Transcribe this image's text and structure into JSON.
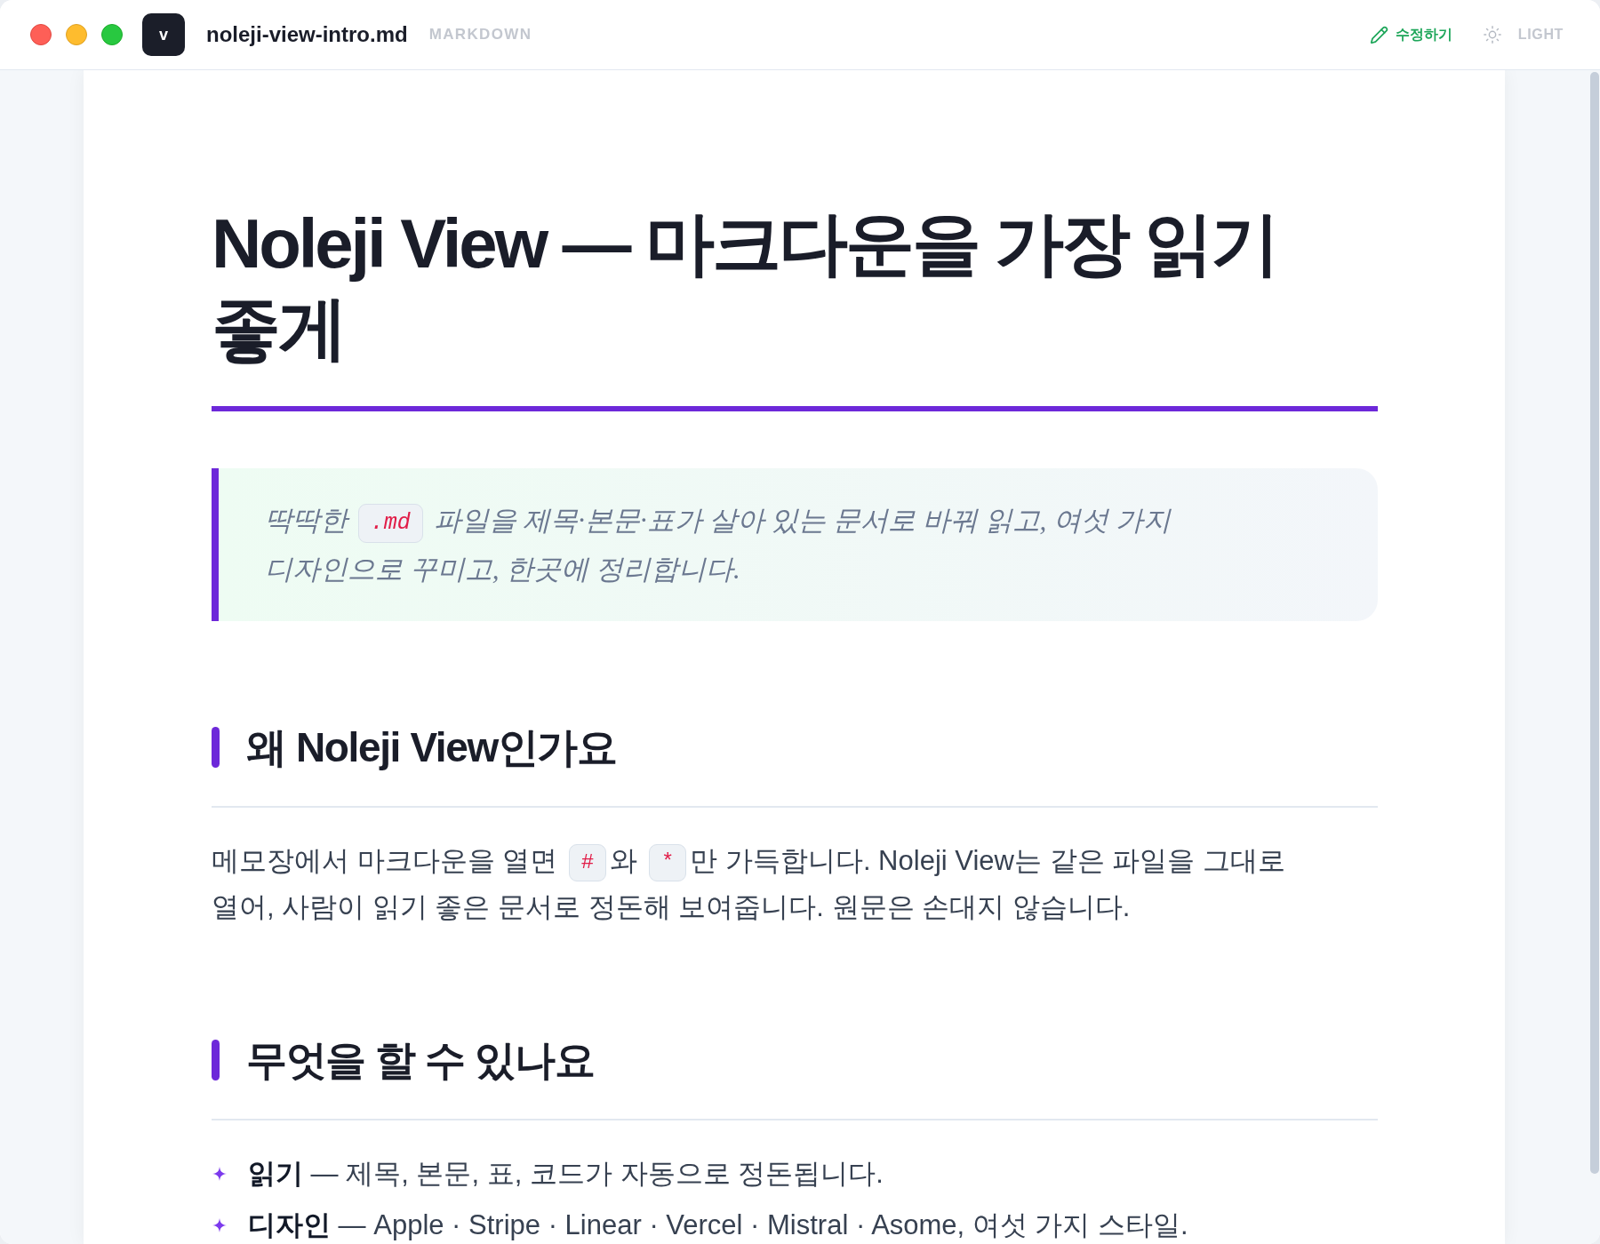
{
  "app": {
    "logo_letter": "v",
    "file_name": "noleji-view-intro.md",
    "file_type": "MARKDOWN"
  },
  "toolbar": {
    "edit_label": "수정하기",
    "theme_label": "LIGHT"
  },
  "document": {
    "title": "Noleji View — 마크다운을 가장 읽기 좋게",
    "summary": {
      "parts": [
        {
          "kind": "text",
          "text": "딱딱한 "
        },
        {
          "kind": "code",
          "text": ".md"
        },
        {
          "kind": "text",
          "text": " 파일을 제목·본문·표가 살아 있는 문서로 바꿔 읽고, 여섯 가지 디자인으로 꾸미고, 한곳에 정리합니다."
        }
      ]
    },
    "sections": [
      {
        "heading": "왜 Noleji View인가요",
        "blocks": [
          {
            "kind": "paragraph",
            "parts": [
              {
                "kind": "text",
                "text": "메모장에서 마크다운을 열면 "
              },
              {
                "kind": "code",
                "text": "#"
              },
              {
                "kind": "text",
                "text": "와 "
              },
              {
                "kind": "code",
                "text": "*"
              },
              {
                "kind": "text",
                "text": "만 가득합니다. Noleji View는 같은 파일을 그대로 열어, 사람이 읽기 좋은 문서로 정돈해 보여줍니다. 원문은 손대지 않습니다."
              }
            ]
          }
        ]
      },
      {
        "heading": "무엇을 할 수 있나요",
        "blocks": [
          {
            "kind": "list",
            "items": [
              "**읽기** — 제목, 본문, 표, 코드가 자동으로 정돈됩니다.",
              "**디자인** — Apple · Stripe · Linear · Vercel · Mistral · Asome, 여섯 가지 스타일."
            ]
          }
        ]
      }
    ]
  }
}
